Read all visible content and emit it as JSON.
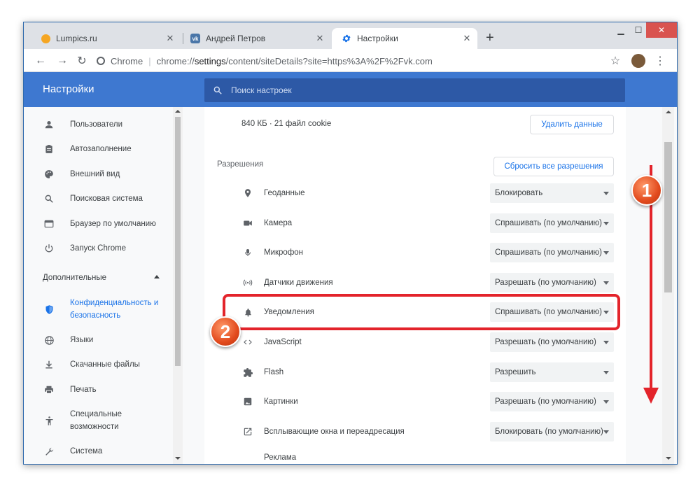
{
  "tabs": [
    {
      "title": "Lumpics.ru",
      "favicon": "orange-circle-icon"
    },
    {
      "title": "Андрей Петров",
      "favicon": "vk-icon"
    },
    {
      "title": "Настройки",
      "favicon": "gear-icon"
    }
  ],
  "toolbar": {
    "omnibox_chip": "Chrome",
    "url_scheme": "chrome://",
    "url_host": "settings",
    "url_path": "/content/siteDetails?site=https%3A%2F%2Fvk.com"
  },
  "app": {
    "title": "Настройки",
    "search_placeholder": "Поиск настроек"
  },
  "sidebar": {
    "items": [
      {
        "label": "Пользователи",
        "icon": "person-icon"
      },
      {
        "label": "Автозаполнение",
        "icon": "clipboard-icon"
      },
      {
        "label": "Внешний вид",
        "icon": "palette-icon"
      },
      {
        "label": "Поисковая система",
        "icon": "search-icon"
      },
      {
        "label": "Браузер по умолчанию",
        "icon": "browser-icon"
      },
      {
        "label": "Запуск Chrome",
        "icon": "power-icon"
      }
    ],
    "advanced_header": "Дополнительные",
    "advanced_items": [
      {
        "label_line1": "Конфиденциальность и",
        "label_line2": "безопасность",
        "icon": "shield-icon",
        "active": true
      },
      {
        "label": "Языки",
        "icon": "globe-icon"
      },
      {
        "label": "Скачанные файлы",
        "icon": "download-icon"
      },
      {
        "label": "Печать",
        "icon": "printer-icon"
      },
      {
        "label_line1": "Специальные",
        "label_line2": "возможности",
        "icon": "accessibility-icon"
      },
      {
        "label": "Система",
        "icon": "wrench-icon"
      }
    ]
  },
  "site": {
    "usage": "840 КБ · 21 файл cookie",
    "clear_button": "Удалить данные",
    "permissions_header": "Разрешения",
    "reset_button": "Сбросить все разрешения"
  },
  "permissions": [
    {
      "name": "Геоданные",
      "value": "Блокировать",
      "icon": "location-pin-icon"
    },
    {
      "name": "Камера",
      "value": "Спрашивать (по умолчанию)",
      "icon": "camera-icon"
    },
    {
      "name": "Микрофон",
      "value": "Спрашивать (по умолчанию)",
      "icon": "microphone-icon"
    },
    {
      "name": "Датчики движения",
      "value": "Разрешать (по умолчанию)",
      "icon": "motion-sensor-icon"
    },
    {
      "name": "Уведомления",
      "value": "Спрашивать (по умолчанию)",
      "icon": "bell-icon"
    },
    {
      "name": "JavaScript",
      "value": "Разрешать (по умолчанию)",
      "icon": "code-icon"
    },
    {
      "name": "Flash",
      "value": "Разрешить",
      "icon": "puzzle-icon"
    },
    {
      "name": "Картинки",
      "value": "Разрешать (по умолчанию)",
      "icon": "image-icon"
    },
    {
      "name": "Всплывающие окна и переадресация",
      "value": "Блокировать (по умолчанию)",
      "icon": "open-in-new-icon"
    },
    {
      "name": "Реклама",
      "value": "",
      "icon": ""
    }
  ],
  "annotations": {
    "badge1": "1",
    "badge2": "2",
    "accent": "#e3242b"
  }
}
